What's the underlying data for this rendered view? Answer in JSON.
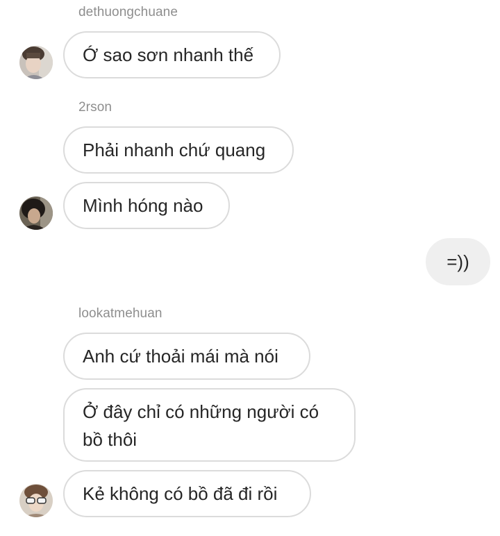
{
  "conversation": {
    "groups": [
      {
        "sender": "dethuongchuane",
        "messages": [
          "Ớ sao sơn nhanh thế"
        ]
      },
      {
        "sender": "2rson",
        "messages": [
          "Phải nhanh chứ quang",
          "Mình hóng nào"
        ]
      },
      {
        "sender": "",
        "outgoing": true,
        "messages": [
          "=))"
        ]
      },
      {
        "sender": "lookatmehuan",
        "messages": [
          "Anh cứ thoải mái mà nói",
          "Ở đây chỉ có những người có bồ thôi",
          "Kẻ không có bồ đã đi rồi"
        ]
      }
    ]
  },
  "colors": {
    "sender_text": "#8e8e8e",
    "bubble_border": "#dbdbdb",
    "outgoing_bubble": "#efefef",
    "text": "#262626"
  }
}
